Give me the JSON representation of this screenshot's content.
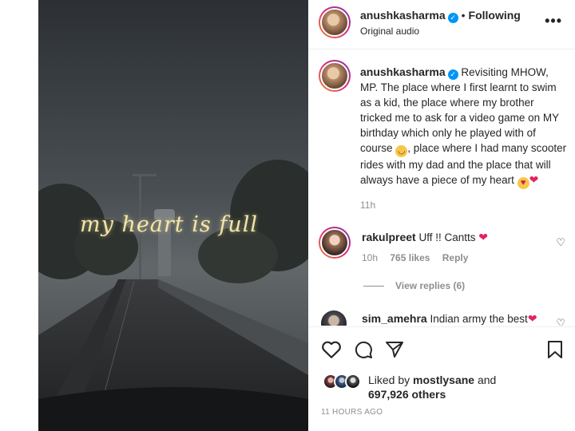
{
  "media": {
    "overlay_text": "my heart is full"
  },
  "header": {
    "username": "anushkasharma",
    "follow_status": "Following",
    "audio": "Original audio",
    "more_icon": "more-horizontal-icon"
  },
  "caption": {
    "username": "anushkasharma",
    "text_1": "Revisiting MHOW, MP. The place where I first learnt to swim as a kid, the place where my brother tricked me to ask for a video game on MY birthday which only he played with of course",
    "text_2": ", place where I had many scooter rides with my dad and the place that will always have a piece of my heart",
    "time": "11h"
  },
  "comments": [
    {
      "username": "rakulpreet",
      "text": "Uff !! Cantts",
      "time": "10h",
      "likes": "765 likes",
      "reply_label": "Reply",
      "view_replies": "View replies (6)"
    },
    {
      "username": "sim_amehra",
      "text": "Indian army the best"
    }
  ],
  "actions": {
    "icons": [
      "heart-icon",
      "comment-icon",
      "share-icon",
      "bookmark-icon"
    ],
    "liked_by_prefix": "Liked by",
    "liked_by_user": "mostlysane",
    "liked_by_and": "and",
    "liked_by_others": "697,926 others",
    "time_ago": "11 HOURS AGO"
  },
  "colors": {
    "verified": "#0095f6",
    "heart_red": "#e0245e",
    "secondary_text": "#8e8e8e"
  }
}
